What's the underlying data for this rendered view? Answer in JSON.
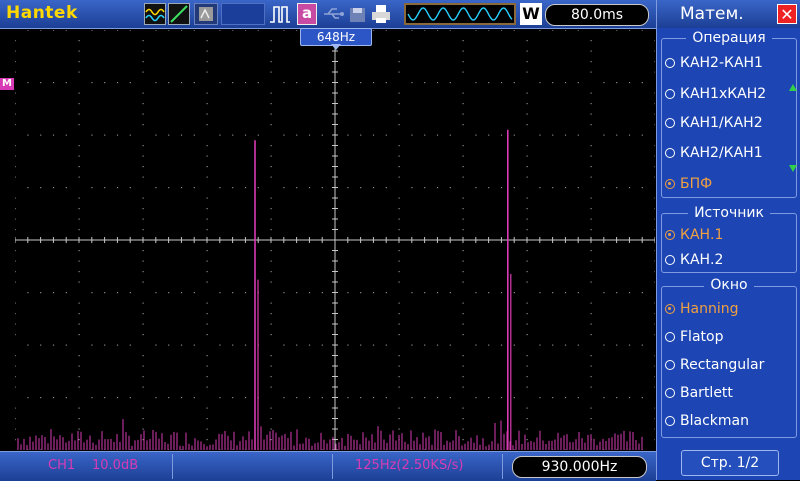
{
  "topbar": {
    "brand": "Hantek",
    "math_icon_label": "a",
    "w_label": "W",
    "timebase": "80.0ms"
  },
  "display": {
    "marker_freq": "648Hz",
    "math_channel_label": "M"
  },
  "bottombar": {
    "channel": "CH1",
    "scale": "10.0dB",
    "sample_rate": "125Hz(2.50KS/s)",
    "frequency": "930.000Hz"
  },
  "panel": {
    "title": "Матем.",
    "groups": [
      {
        "title": "Операция",
        "options": [
          "КАН2-КАН1",
          "КАН1хКАН2",
          "КАН1/КАН2",
          "КАН2/КАН1",
          "БПФ"
        ],
        "selected": 4
      },
      {
        "title": "Источник",
        "options": [
          "КАН.1",
          "КАН.2"
        ],
        "selected": 0
      },
      {
        "title": "Окно",
        "options": [
          "Hanning",
          "Flatop",
          "Rectangular",
          "Bartlett",
          "Blackman"
        ],
        "selected": 0
      }
    ],
    "page": "Стр. 1/2"
  },
  "colors": {
    "trace": "#d83bb5",
    "selected": "#f0a040",
    "panel_bg": "#1d46b4",
    "brand": "#ffd800"
  },
  "chart_data": {
    "type": "line",
    "x_unit": "divisions",
    "y_unit": "divisions",
    "noise_floor_divisions": 0.35,
    "peaks": [
      {
        "x": 3.75,
        "height": 5.9
      },
      {
        "x": 7.7,
        "height": 6.1
      }
    ]
  }
}
